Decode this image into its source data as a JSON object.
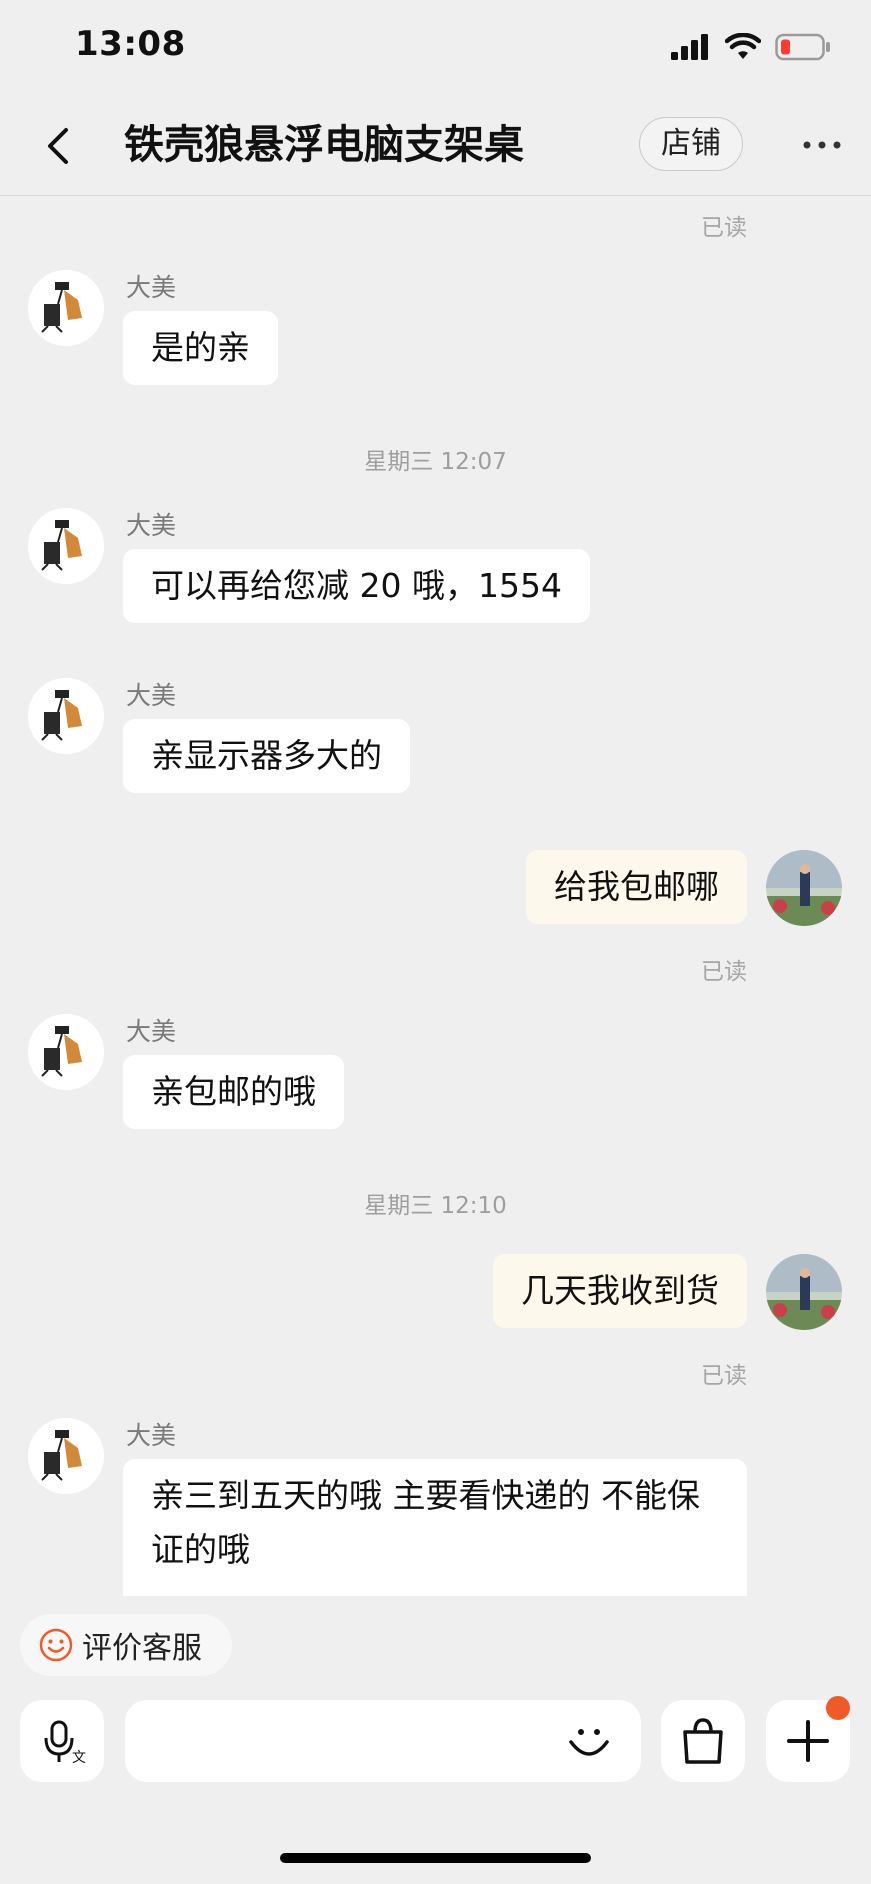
{
  "status_bar": {
    "time": "13:08"
  },
  "header": {
    "title": "铁壳狼悬浮电脑支架桌",
    "shop_button": "店铺"
  },
  "messages": {
    "read_top": "已读",
    "m1": {
      "sender": "大美",
      "text": "是的亲"
    },
    "ts1": "星期三 12:07",
    "m2": {
      "sender": "大美",
      "text": "可以再给您减 20 哦，1554"
    },
    "m3": {
      "sender": "大美",
      "text": "亲显示器多大的"
    },
    "m4": {
      "text": "给我包邮哪",
      "read": "已读"
    },
    "m5": {
      "sender": "大美",
      "text": "亲包邮的哦"
    },
    "ts2": "星期三 12:10",
    "m6": {
      "text": "几天我收到货",
      "read": "已读"
    },
    "m7": {
      "sender": "大美",
      "text": "亲三到五天的哦 主要看快递的 不能保证的哦"
    }
  },
  "footer": {
    "evaluate_label": "评价客服"
  },
  "colors": {
    "accent": "#f05a27",
    "my_bubble": "#fdf8ec",
    "background": "#efefef"
  }
}
